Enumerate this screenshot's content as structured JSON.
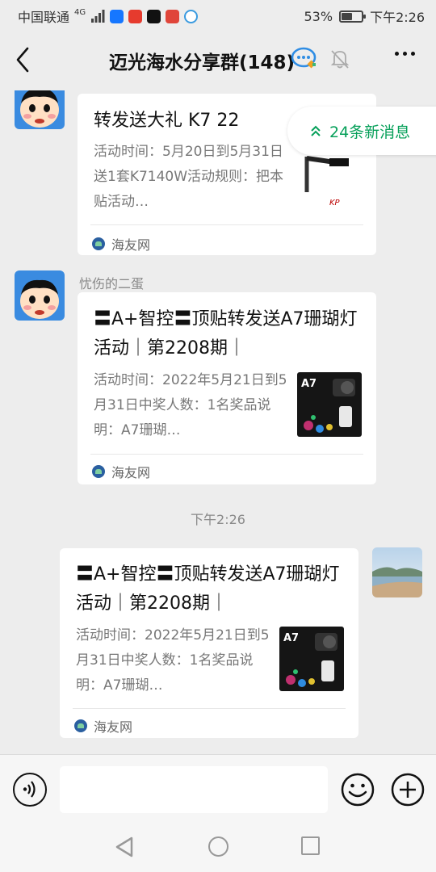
{
  "status_bar": {
    "carrier": "中国联通",
    "network": "4G",
    "battery_percent": "53%",
    "battery_level": 0.53,
    "time": "下午2:26"
  },
  "header": {
    "title": "迈光海水分享群(148)"
  },
  "new_messages_label": "24条新消息",
  "messages": [
    {
      "card_title": "转发送大礼 K7 22",
      "card_desc": "活动时间：5月20日到5月31日送1套K7140W活动规则：把本贴活动…",
      "source": "海友网"
    },
    {
      "sender": "忧伤的二蛋",
      "card_title": "〓A+智控〓顶贴转发送A7珊瑚灯活动｜第2208期｜",
      "card_desc": "活动时间：2022年5月21日到5月31日中奖人数：1名奖品说明：A7珊瑚…",
      "source": "海友网"
    },
    {
      "card_title": "〓A+智控〓顶贴转发送A7珊瑚灯活动｜第2208期｜",
      "card_desc": "活动时间：2022年5月21日到5月31日中奖人数：1名奖品说明：A7珊瑚…",
      "source": "海友网"
    }
  ],
  "timestamp": "下午2:26",
  "thumb_labels": {
    "k7_brand": "KP",
    "a7_title": "A7"
  },
  "colors": {
    "accent_green": "#07a05a",
    "background": "#ededed",
    "card": "#ffffff"
  },
  "icons": {
    "back": "chevron-left-icon",
    "group_chat": "chat-bubble-icon",
    "mute": "bell-muted-icon",
    "more": "more-dots-icon",
    "voice": "voice-icon",
    "emoji": "smile-icon",
    "plus": "plus-icon"
  }
}
